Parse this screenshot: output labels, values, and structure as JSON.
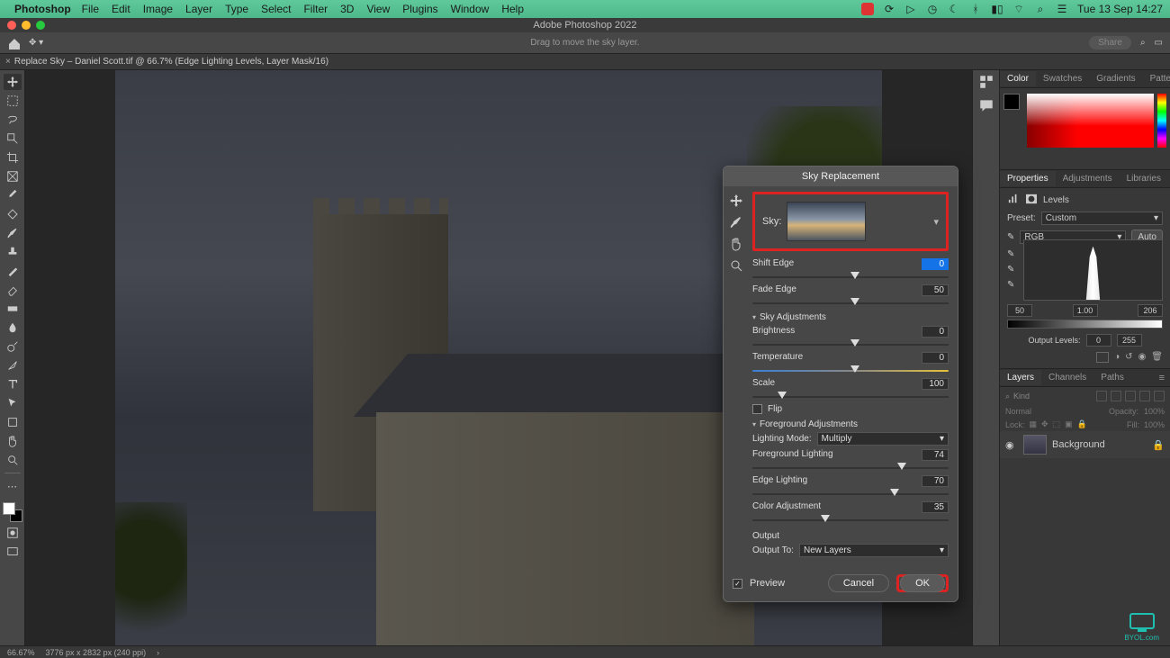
{
  "mac_menu": {
    "app": "Photoshop",
    "items": [
      "File",
      "Edit",
      "Image",
      "Layer",
      "Type",
      "Select",
      "Filter",
      "3D",
      "View",
      "Plugins",
      "Window",
      "Help"
    ],
    "clock": "Tue 13 Sep  14:27"
  },
  "app_title": "Adobe Photoshop 2022",
  "options_hint": "Drag to move the sky layer.",
  "share_label": "Share",
  "document_tab": "Replace Sky – Daniel Scott.tif @ 66.7% (Edge Lighting Levels, Layer Mask/16)",
  "status": {
    "zoom": "66.67%",
    "dims": "3776 px x 2832 px (240 ppi)"
  },
  "color_tabs": [
    "Color",
    "Swatches",
    "Gradients",
    "Patterns"
  ],
  "prop_tabs": [
    "Properties",
    "Adjustments",
    "Libraries"
  ],
  "levels": {
    "title": "Levels",
    "preset_label": "Preset:",
    "preset": "Custom",
    "channel": "RGB",
    "auto": "Auto",
    "in_low": "50",
    "in_mid": "1.00",
    "in_high": "206",
    "out_label": "Output Levels:",
    "out_low": "0",
    "out_high": "255"
  },
  "layer_tabs": [
    "Layers",
    "Channels",
    "Paths"
  ],
  "layers": {
    "kind": "Kind",
    "blend": "Normal",
    "opacity_label": "Opacity:",
    "opacity": "100%",
    "lock_label": "Lock:",
    "fill_label": "Fill:",
    "fill": "100%",
    "bg_name": "Background"
  },
  "dialog": {
    "title": "Sky Replacement",
    "sky_label": "Sky:",
    "shift_edge": {
      "label": "Shift Edge",
      "value": "0",
      "pos": 50
    },
    "fade_edge": {
      "label": "Fade Edge",
      "value": "50",
      "pos": 50
    },
    "sky_adj_hdr": "Sky Adjustments",
    "brightness": {
      "label": "Brightness",
      "value": "0",
      "pos": 50
    },
    "temperature": {
      "label": "Temperature",
      "value": "0",
      "pos": 50
    },
    "scale": {
      "label": "Scale",
      "value": "100",
      "pos": 13
    },
    "flip": "Flip",
    "fg_adj_hdr": "Foreground Adjustments",
    "lighting_mode_label": "Lighting Mode:",
    "lighting_mode": "Multiply",
    "fg_lighting": {
      "label": "Foreground Lighting",
      "value": "74",
      "pos": 74
    },
    "edge_lighting": {
      "label": "Edge Lighting",
      "value": "70",
      "pos": 70
    },
    "color_adj": {
      "label": "Color Adjustment",
      "value": "35",
      "pos": 35
    },
    "output_hdr": "Output",
    "output_to_label": "Output To:",
    "output_to": "New Layers",
    "preview": "Preview",
    "cancel": "Cancel",
    "ok": "OK"
  },
  "watermark": "BYOL.com"
}
